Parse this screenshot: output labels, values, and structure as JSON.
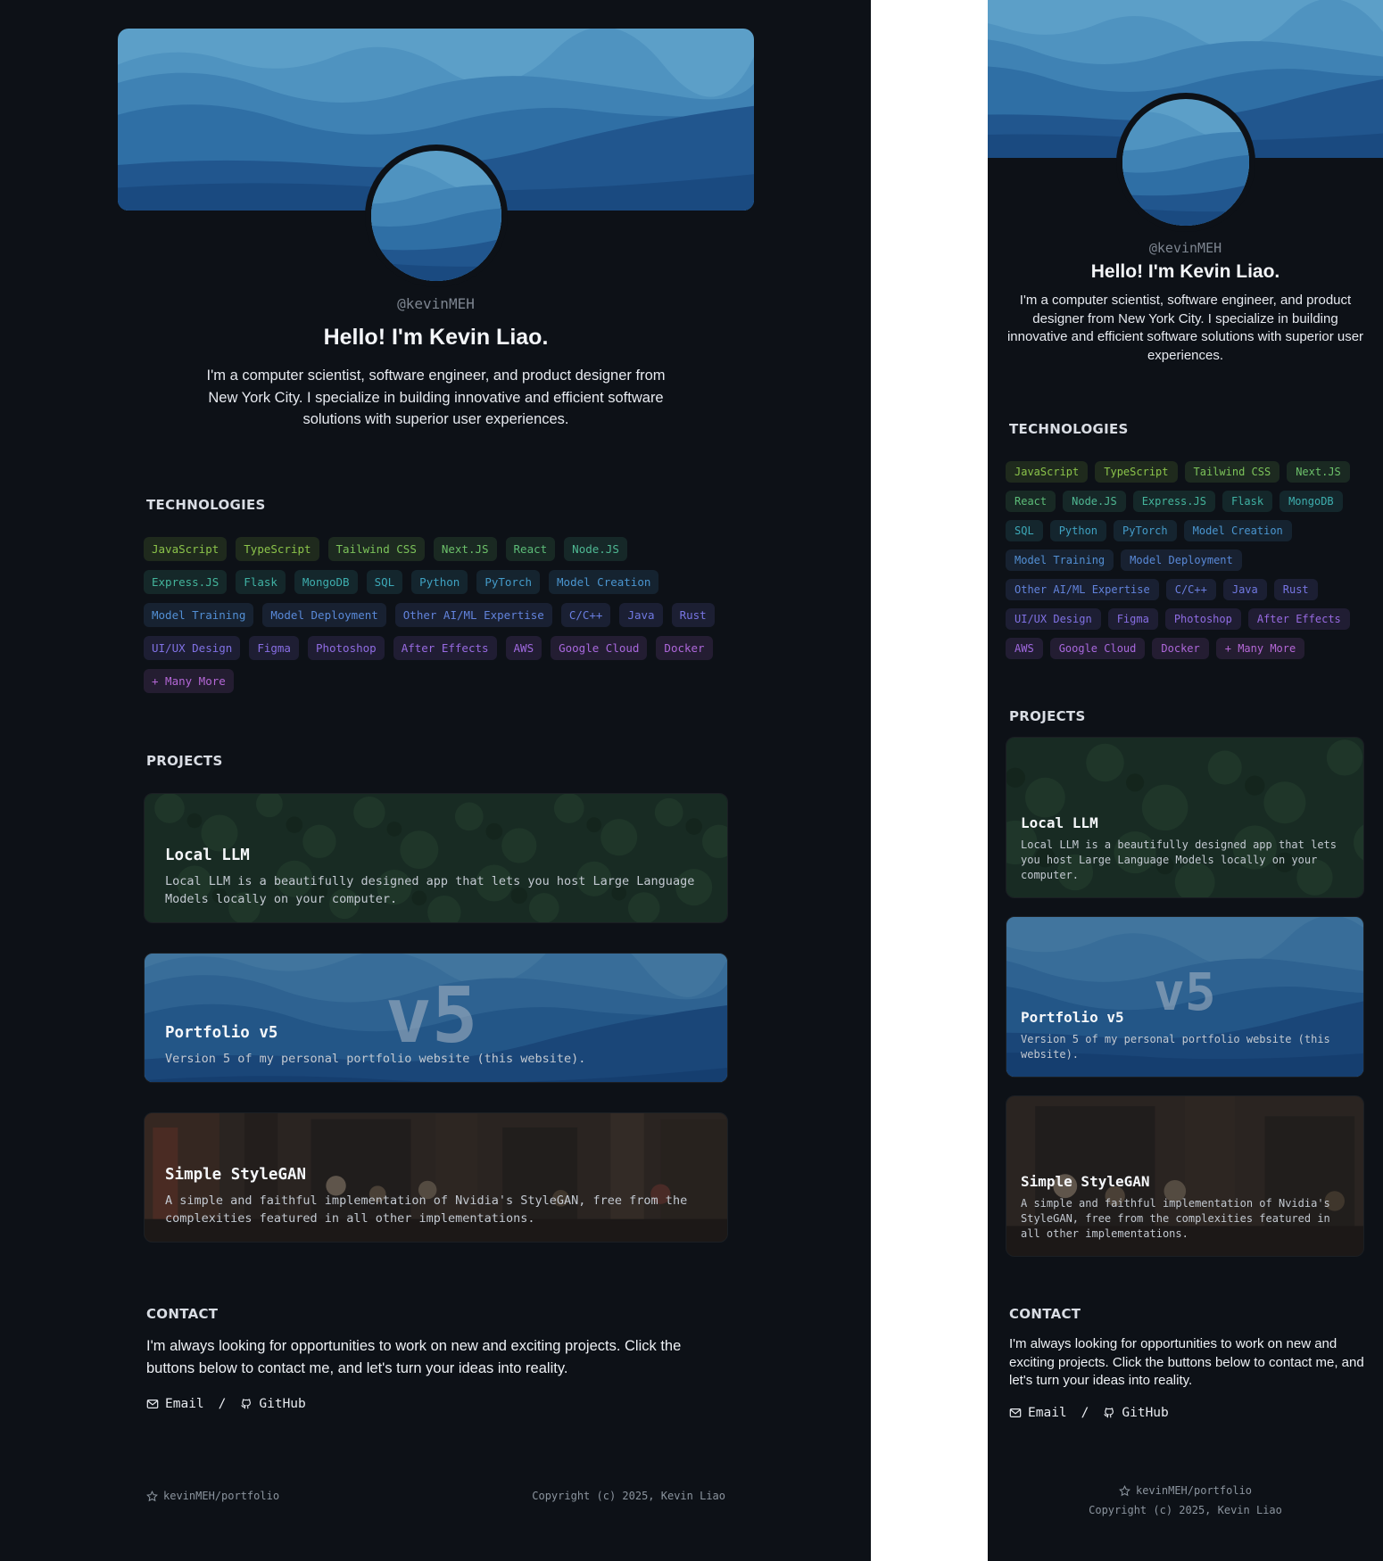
{
  "profile": {
    "handle": "@kevinMEH",
    "greeting": "Hello! I'm Kevin Liao.",
    "bio": "I'm a computer scientist, software engineer, and product designer from New York City. I specialize in building innovative and efficient software solutions with superior user experiences."
  },
  "sections": {
    "technologies": "TECHNOLOGIES",
    "projects": "PROJECTS",
    "contact": "CONTACT"
  },
  "technologies": [
    {
      "label": "JavaScript",
      "color": "#8bc34a"
    },
    {
      "label": "TypeScript",
      "color": "#8bc34a"
    },
    {
      "label": "Tailwind CSS",
      "color": "#7cc35a"
    },
    {
      "label": "Next.JS",
      "color": "#6cc06a"
    },
    {
      "label": "React",
      "color": "#5cbc78"
    },
    {
      "label": "Node.JS",
      "color": "#4fb893"
    },
    {
      "label": "Express.JS",
      "color": "#44b59c"
    },
    {
      "label": "Flask",
      "color": "#40b2a4"
    },
    {
      "label": "MongoDB",
      "color": "#3eaeae"
    },
    {
      "label": "SQL",
      "color": "#3da9b8"
    },
    {
      "label": "Python",
      "color": "#3fa2c2"
    },
    {
      "label": "PyTorch",
      "color": "#449bc9"
    },
    {
      "label": "Model Creation",
      "color": "#4a95cf"
    },
    {
      "label": "Model Training",
      "color": "#528fd4"
    },
    {
      "label": "Model Deployment",
      "color": "#5989d8"
    },
    {
      "label": "Other AI/ML Expertise",
      "color": "#6283dc"
    },
    {
      "label": "C/C++",
      "color": "#6a7ee0"
    },
    {
      "label": "Java",
      "color": "#7079e2"
    },
    {
      "label": "Rust",
      "color": "#7875e3"
    },
    {
      "label": "UI/UX Design",
      "color": "#8071e4"
    },
    {
      "label": "Figma",
      "color": "#886ee4"
    },
    {
      "label": "Photoshop",
      "color": "#906ce3"
    },
    {
      "label": "After Effects",
      "color": "#986ae2"
    },
    {
      "label": "AWS",
      "color": "#a069e0"
    },
    {
      "label": "Google Cloud",
      "color": "#a868dd"
    },
    {
      "label": "Docker",
      "color": "#ae67da"
    },
    {
      "label": "+ Many More",
      "color": "#b467d6"
    }
  ],
  "projects": [
    {
      "title": "Local LLM",
      "description": "Local LLM is a beautifully designed app that lets you host Large Language Models locally on your computer."
    },
    {
      "title": "Portfolio v5",
      "description": "Version 5 of my personal portfolio website (this website).",
      "badge": "v5"
    },
    {
      "title": "Simple StyleGAN",
      "description": "A simple and faithful implementation of Nvidia's StyleGAN, free from the complexities featured in all other implementations."
    }
  ],
  "contact": {
    "text": "I'm always looking for opportunities to work on new and exciting projects. Click the buttons below to contact me, and let's turn your ideas into reality.",
    "email_label": "Email",
    "separator": "/",
    "github_label": "GitHub"
  },
  "footer": {
    "repo": "kevinMEH/portfolio",
    "copyright": "Copyright (c) 2025, Kevin Liao"
  },
  "colors": {
    "background": "#0d1117",
    "text_muted": "#7d8590"
  }
}
